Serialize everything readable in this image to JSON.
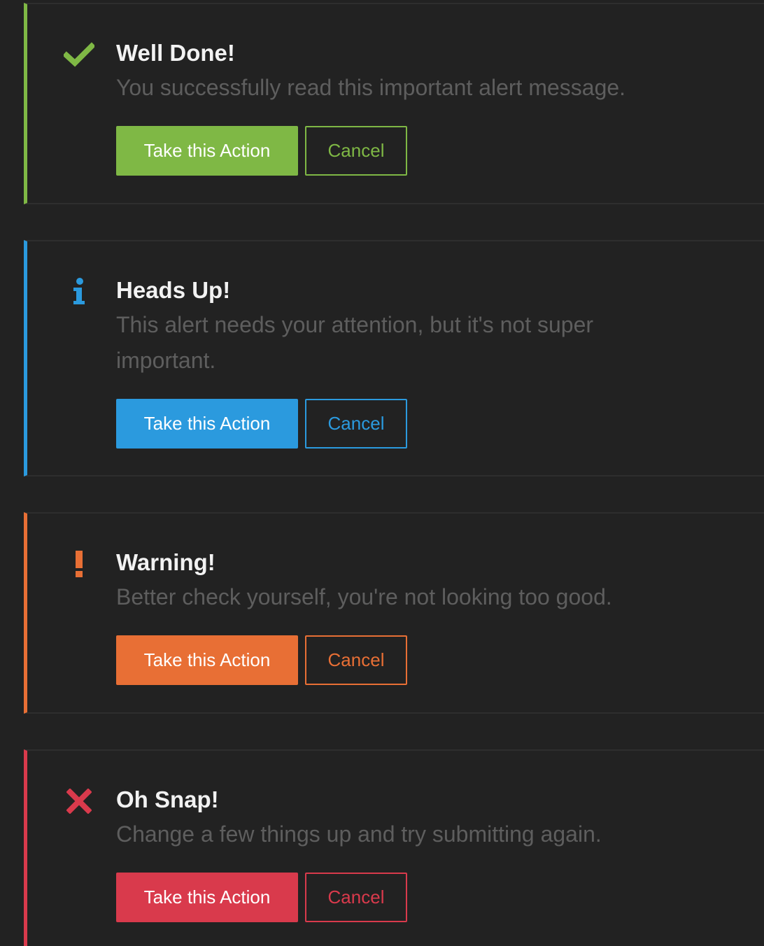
{
  "colors": {
    "background": "#222222",
    "success": "#7fb845",
    "info": "#2b9ade",
    "warning": "#e86f35",
    "danger": "#d93a4c"
  },
  "alerts": [
    {
      "type": "success",
      "icon": "checkmark-icon",
      "title": "Well Done!",
      "message": "You successfully read this important alert message.",
      "action_label": "Take this Action",
      "cancel_label": "Cancel"
    },
    {
      "type": "info",
      "icon": "info-icon",
      "title": "Heads Up!",
      "message": "This alert needs your attention, but it's not super important.",
      "action_label": "Take this Action",
      "cancel_label": "Cancel"
    },
    {
      "type": "warning",
      "icon": "exclamation-icon",
      "title": "Warning!",
      "message": "Better check yourself, you're not looking too good.",
      "action_label": "Take this Action",
      "cancel_label": "Cancel"
    },
    {
      "type": "danger",
      "icon": "close-x-icon",
      "title": "Oh Snap!",
      "message": "Change a few things up and try submitting again.",
      "action_label": "Take this Action",
      "cancel_label": "Cancel"
    }
  ]
}
